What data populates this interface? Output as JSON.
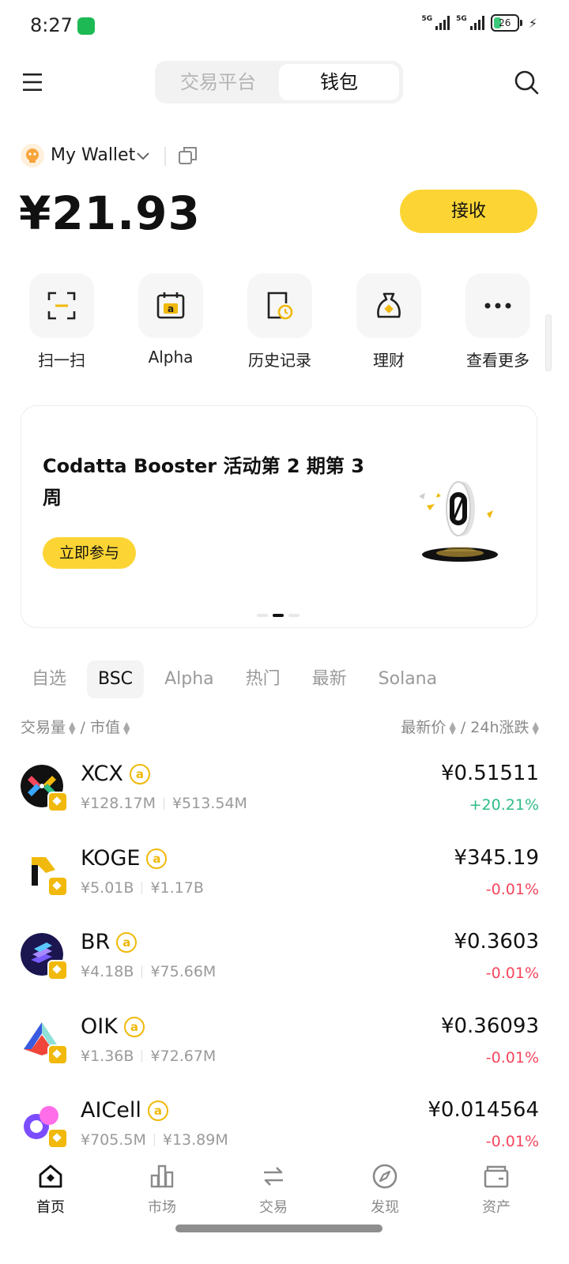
{
  "status_bar": {
    "time": "8:27",
    "net1": "5G",
    "net2": "5G",
    "battery": "26"
  },
  "header": {
    "tabs": [
      "交易平台",
      "钱包"
    ],
    "active_tab": "钱包"
  },
  "wallet": {
    "name": "My Wallet",
    "balance": "¥21.93",
    "receive_label": "接收"
  },
  "quick_actions": [
    {
      "label": "扫一扫",
      "icon": "scan-icon"
    },
    {
      "label": "Alpha",
      "icon": "alpha-calendar-icon"
    },
    {
      "label": "历史记录",
      "icon": "history-icon"
    },
    {
      "label": "理财",
      "icon": "earn-bag-icon"
    },
    {
      "label": "查看更多",
      "icon": "more-icon"
    }
  ],
  "banner": {
    "title": "Codatta Booster 活动第 2 期第 3 周",
    "button": "立即参与",
    "page": 2,
    "pages": 3
  },
  "market_tabs": [
    "自选",
    "BSC",
    "Alpha",
    "热门",
    "最新",
    "Solana"
  ],
  "active_market_tab": "BSC",
  "sort": {
    "left": "交易量",
    "left2": "市值",
    "right": "最新价",
    "right2": "24h涨跌",
    "divider": "/"
  },
  "tokens": [
    {
      "symbol": "XCX",
      "volume": "¥128.17M",
      "mcap": "¥513.54M",
      "price": "¥0.51511",
      "change": "+20.21%",
      "dir": "up"
    },
    {
      "symbol": "KOGE",
      "volume": "¥5.01B",
      "mcap": "¥1.17B",
      "price": "¥345.19",
      "change": "-0.01%",
      "dir": "down"
    },
    {
      "symbol": "BR",
      "volume": "¥4.18B",
      "mcap": "¥75.66M",
      "price": "¥0.3603",
      "change": "-0.01%",
      "dir": "down"
    },
    {
      "symbol": "OIK",
      "volume": "¥1.36B",
      "mcap": "¥72.67M",
      "price": "¥0.36093",
      "change": "-0.01%",
      "dir": "down"
    },
    {
      "symbol": "AICell",
      "volume": "¥705.5M",
      "mcap": "¥13.89M",
      "price": "¥0.014564",
      "change": "-0.01%",
      "dir": "down"
    }
  ],
  "alpha_mark": "a",
  "bottom_nav": [
    {
      "label": "首页",
      "active": true
    },
    {
      "label": "市场",
      "active": false
    },
    {
      "label": "交易",
      "active": false
    },
    {
      "label": "发现",
      "active": false
    },
    {
      "label": "资产",
      "active": false
    }
  ],
  "colors": {
    "accent": "#fcd535",
    "up": "#2ebd85",
    "down": "#f6465d",
    "bnb": "#f0b90b"
  }
}
